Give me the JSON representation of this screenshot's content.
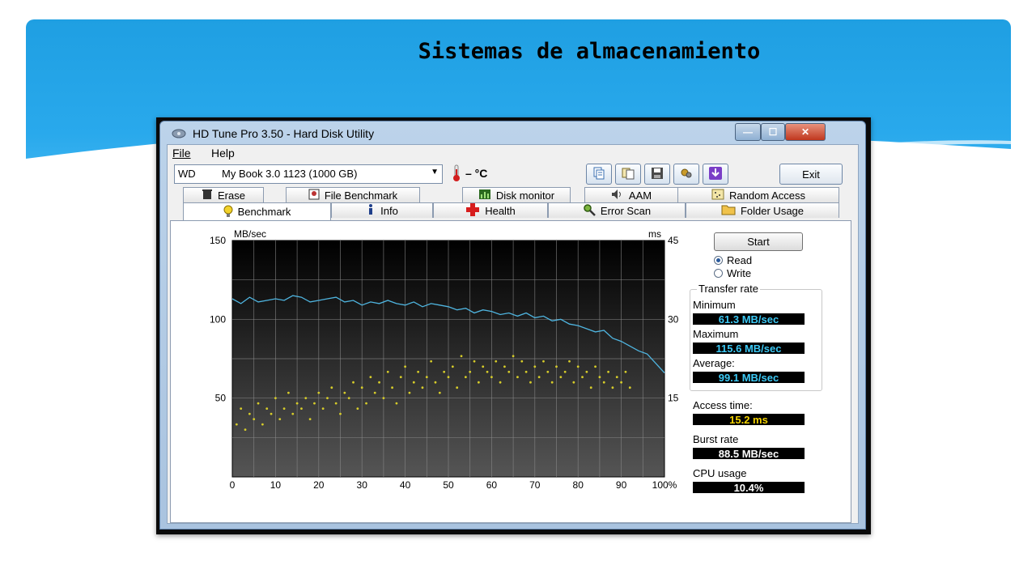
{
  "slide": {
    "title": "Sistemas de almacenamiento"
  },
  "window": {
    "title": "HD Tune Pro 3.50 - Hard Disk Utility",
    "controls": {
      "minimize": "—",
      "maximize": "☐",
      "close": "✕"
    }
  },
  "menu": {
    "file": "File",
    "help": "Help"
  },
  "toolbar": {
    "drive_vendor": "WD",
    "drive_model": "My Book 3.0 1123 (1000 GB)",
    "temperature": "– °C",
    "exit_label": "Exit",
    "icons": [
      "copy-text-icon",
      "copy-screenshot-icon",
      "save-icon",
      "options-icon",
      "download-icon"
    ]
  },
  "tabs": {
    "row1": [
      {
        "label": "Erase",
        "icon": "trash-icon"
      },
      {
        "label": "File Benchmark",
        "icon": "file-benchmark-icon"
      },
      {
        "label": "Disk monitor",
        "icon": "disk-monitor-icon"
      },
      {
        "label": "AAM",
        "icon": "speaker-icon"
      },
      {
        "label": "Random Access",
        "icon": "random-access-icon"
      }
    ],
    "row2": [
      {
        "label": "Benchmark",
        "icon": "lightbulb-icon",
        "active": true
      },
      {
        "label": "Info",
        "icon": "info-icon"
      },
      {
        "label": "Health",
        "icon": "health-cross-icon"
      },
      {
        "label": "Error Scan",
        "icon": "magnifier-icon"
      },
      {
        "label": "Folder Usage",
        "icon": "folder-icon"
      }
    ]
  },
  "controls": {
    "start_label": "Start",
    "read_label": "Read",
    "write_label": "Write",
    "selected_mode": "Read"
  },
  "stats": {
    "transfer_rate_label": "Transfer rate",
    "minimum_label": "Minimum",
    "minimum_value": "61.3 MB/sec",
    "maximum_label": "Maximum",
    "maximum_value": "115.6 MB/sec",
    "average_label": "Average:",
    "average_value": "99.1 MB/sec",
    "access_time_label": "Access time:",
    "access_time_value": "15.2 ms",
    "burst_rate_label": "Burst rate",
    "burst_rate_value": "88.5 MB/sec",
    "cpu_usage_label": "CPU usage",
    "cpu_usage_value": "10.4%"
  },
  "colors": {
    "transfer_line": "#4fb5e0",
    "access_points": "#d6cc2a",
    "chart_bg_top": "#000000",
    "chart_bg_bottom": "#555555"
  },
  "chart_data": {
    "type": "line",
    "y_left_label": "MB/sec",
    "y_right_label": "ms",
    "xlim": [
      0,
      100
    ],
    "ylim_left": [
      0,
      150
    ],
    "ylim_right": [
      0,
      45
    ],
    "x_ticks": [
      "0",
      "10",
      "20",
      "30",
      "40",
      "50",
      "60",
      "70",
      "80",
      "90",
      "100%"
    ],
    "y_left_ticks": [
      "50",
      "100",
      "150"
    ],
    "y_right_ticks": [
      "15",
      "30",
      "45"
    ],
    "grid": true,
    "series": [
      {
        "name": "Transfer rate",
        "axis": "left",
        "x": [
          0,
          2,
          4,
          6,
          8,
          10,
          12,
          14,
          16,
          18,
          20,
          22,
          24,
          26,
          28,
          30,
          32,
          34,
          36,
          38,
          40,
          42,
          44,
          46,
          48,
          50,
          52,
          54,
          56,
          58,
          60,
          62,
          64,
          66,
          68,
          70,
          72,
          74,
          76,
          78,
          80,
          82,
          84,
          86,
          88,
          90,
          92,
          94,
          96,
          98,
          100
        ],
        "y": [
          113,
          110,
          114,
          111,
          112,
          113,
          112,
          115,
          114,
          111,
          112,
          113,
          114,
          111,
          112,
          109,
          111,
          110,
          112,
          110,
          109,
          111,
          108,
          110,
          109,
          108,
          106,
          107,
          104,
          106,
          105,
          103,
          104,
          102,
          104,
          101,
          102,
          99,
          100,
          97,
          96,
          94,
          92,
          93,
          88,
          86,
          83,
          80,
          78,
          72,
          66
        ]
      },
      {
        "name": "Access time",
        "axis": "right",
        "type": "scatter",
        "x": [
          1,
          2,
          3,
          4,
          5,
          6,
          7,
          8,
          9,
          10,
          11,
          12,
          13,
          14,
          15,
          16,
          17,
          18,
          19,
          20,
          21,
          22,
          23,
          24,
          25,
          26,
          27,
          28,
          29,
          30,
          31,
          32,
          33,
          34,
          35,
          36,
          37,
          38,
          39,
          40,
          41,
          42,
          43,
          44,
          45,
          46,
          47,
          48,
          49,
          50,
          51,
          52,
          53,
          54,
          55,
          56,
          57,
          58,
          59,
          60,
          61,
          62,
          63,
          64,
          65,
          66,
          67,
          68,
          69,
          70,
          71,
          72,
          73,
          74,
          75,
          76,
          77,
          78,
          79,
          80,
          81,
          82,
          83,
          84,
          85,
          86,
          87,
          88,
          89,
          90,
          91,
          92
        ],
        "y": [
          10,
          13,
          9,
          12,
          11,
          14,
          10,
          13,
          12,
          15,
          11,
          13,
          16,
          12,
          14,
          13,
          15,
          11,
          14,
          16,
          13,
          15,
          17,
          14,
          12,
          16,
          15,
          18,
          13,
          17,
          14,
          19,
          16,
          18,
          15,
          20,
          17,
          14,
          19,
          21,
          16,
          18,
          20,
          17,
          19,
          22,
          18,
          16,
          20,
          19,
          21,
          17,
          23,
          19,
          20,
          22,
          18,
          21,
          20,
          19,
          22,
          18,
          21,
          20,
          23,
          19,
          22,
          20,
          18,
          21,
          19,
          22,
          20,
          18,
          21,
          19,
          20,
          22,
          18,
          21,
          19,
          20,
          17,
          21,
          19,
          18,
          20,
          17,
          19,
          18,
          20,
          17
        ]
      }
    ]
  }
}
